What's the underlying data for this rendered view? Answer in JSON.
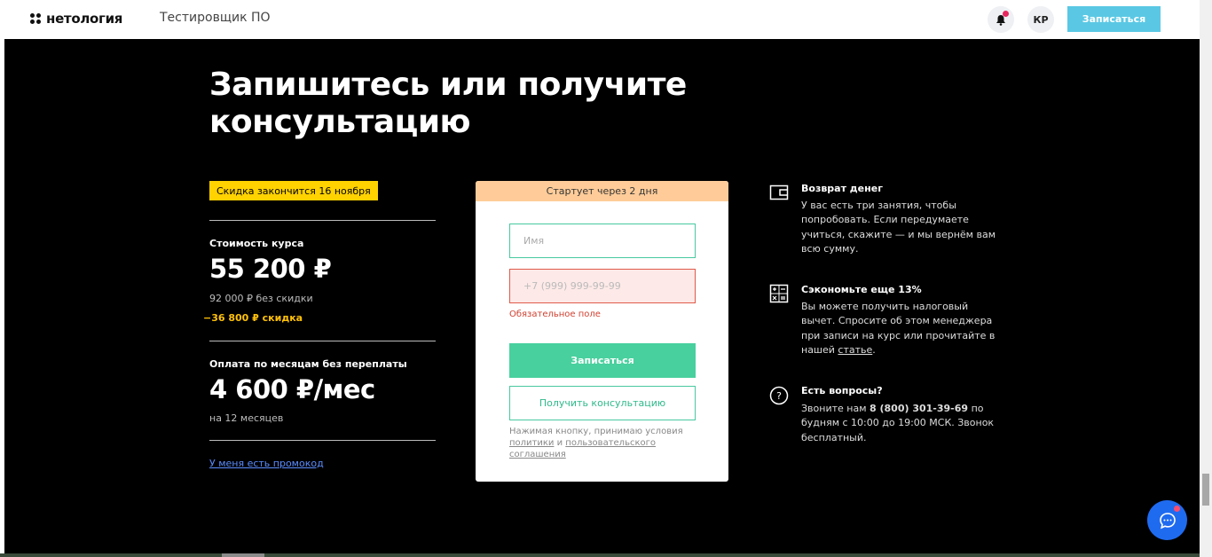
{
  "header": {
    "logo_text": "нетология",
    "course_name": "Тестировщик ПО",
    "avatar_initials": "КР",
    "signup_button": "Записаться"
  },
  "hero": {
    "title_line1": "Запишитесь или получите",
    "title_line2": "консультацию"
  },
  "pricing": {
    "badge": "Скидка закончится 16 ноября",
    "cost_label": "Стоимость курса",
    "price": "55 200 ₽",
    "old_price": "92 000 ₽ без скидки",
    "discount": "−36 800 ₽ скидка",
    "monthly_label": "Оплата по месяцам без переплаты",
    "monthly_price": "4 600 ₽/мес",
    "monthly_term": "на 12 месяцев",
    "promo_link": "У меня есть промокод"
  },
  "form": {
    "header": "Стартует через 2 дня",
    "name_placeholder": "Имя",
    "phone_placeholder": "+7 (999) 999-99-99",
    "error_text": "Обязательное поле",
    "submit_label": "Записаться",
    "consult_label": "Получить консультацию",
    "terms_prefix": "Нажимая кнопку, принимаю условия",
    "terms_link1": "политики",
    "terms_and": "и",
    "terms_link2": "пользовательского соглашения"
  },
  "info": {
    "refund_title": "Возврат денег",
    "refund_text": "У вас есть три занятия, чтобы попробовать. Если передумаете учиться, скажите — и мы вернём вам всю сумму.",
    "tax_title": "Сэкономьте еще 13%",
    "tax_text": "Вы можете получить налоговый вычет. Спросите об этом менеджера при записи на курс или прочитайте в нашей",
    "tax_link": "статье",
    "questions_title": "Есть вопросы?",
    "questions_text_prefix": "Звоните нам",
    "phone": "8 (800) 301-39-69",
    "questions_text_suffix": "по будням с 10:00 до 19:00 МСК. Звонок бесплатный."
  },
  "colors": {
    "accent_green": "#48d09e",
    "header_button": "#5ac8e4",
    "badge_yellow": "#ffd200",
    "discount_yellow": "#ffc107",
    "card_header": "#ffcc99",
    "error_red": "#d04030",
    "chat_blue": "#1f6bf0"
  }
}
